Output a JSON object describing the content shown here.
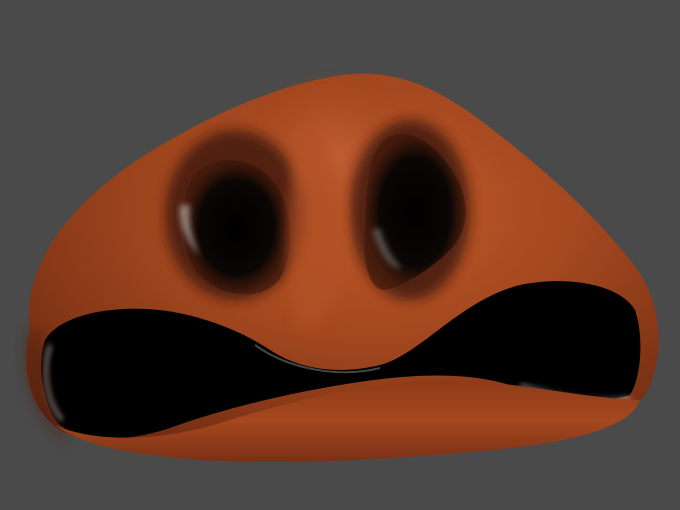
{
  "viewport": {
    "background_color": "#4a4a4a"
  },
  "model": {
    "subject": "sculpted-nose-mesh",
    "material_color": "#a2471f",
    "material_shadow_color": "#5e2410",
    "cavity_color": "#050505",
    "specular_color": "#d8d8d8"
  }
}
